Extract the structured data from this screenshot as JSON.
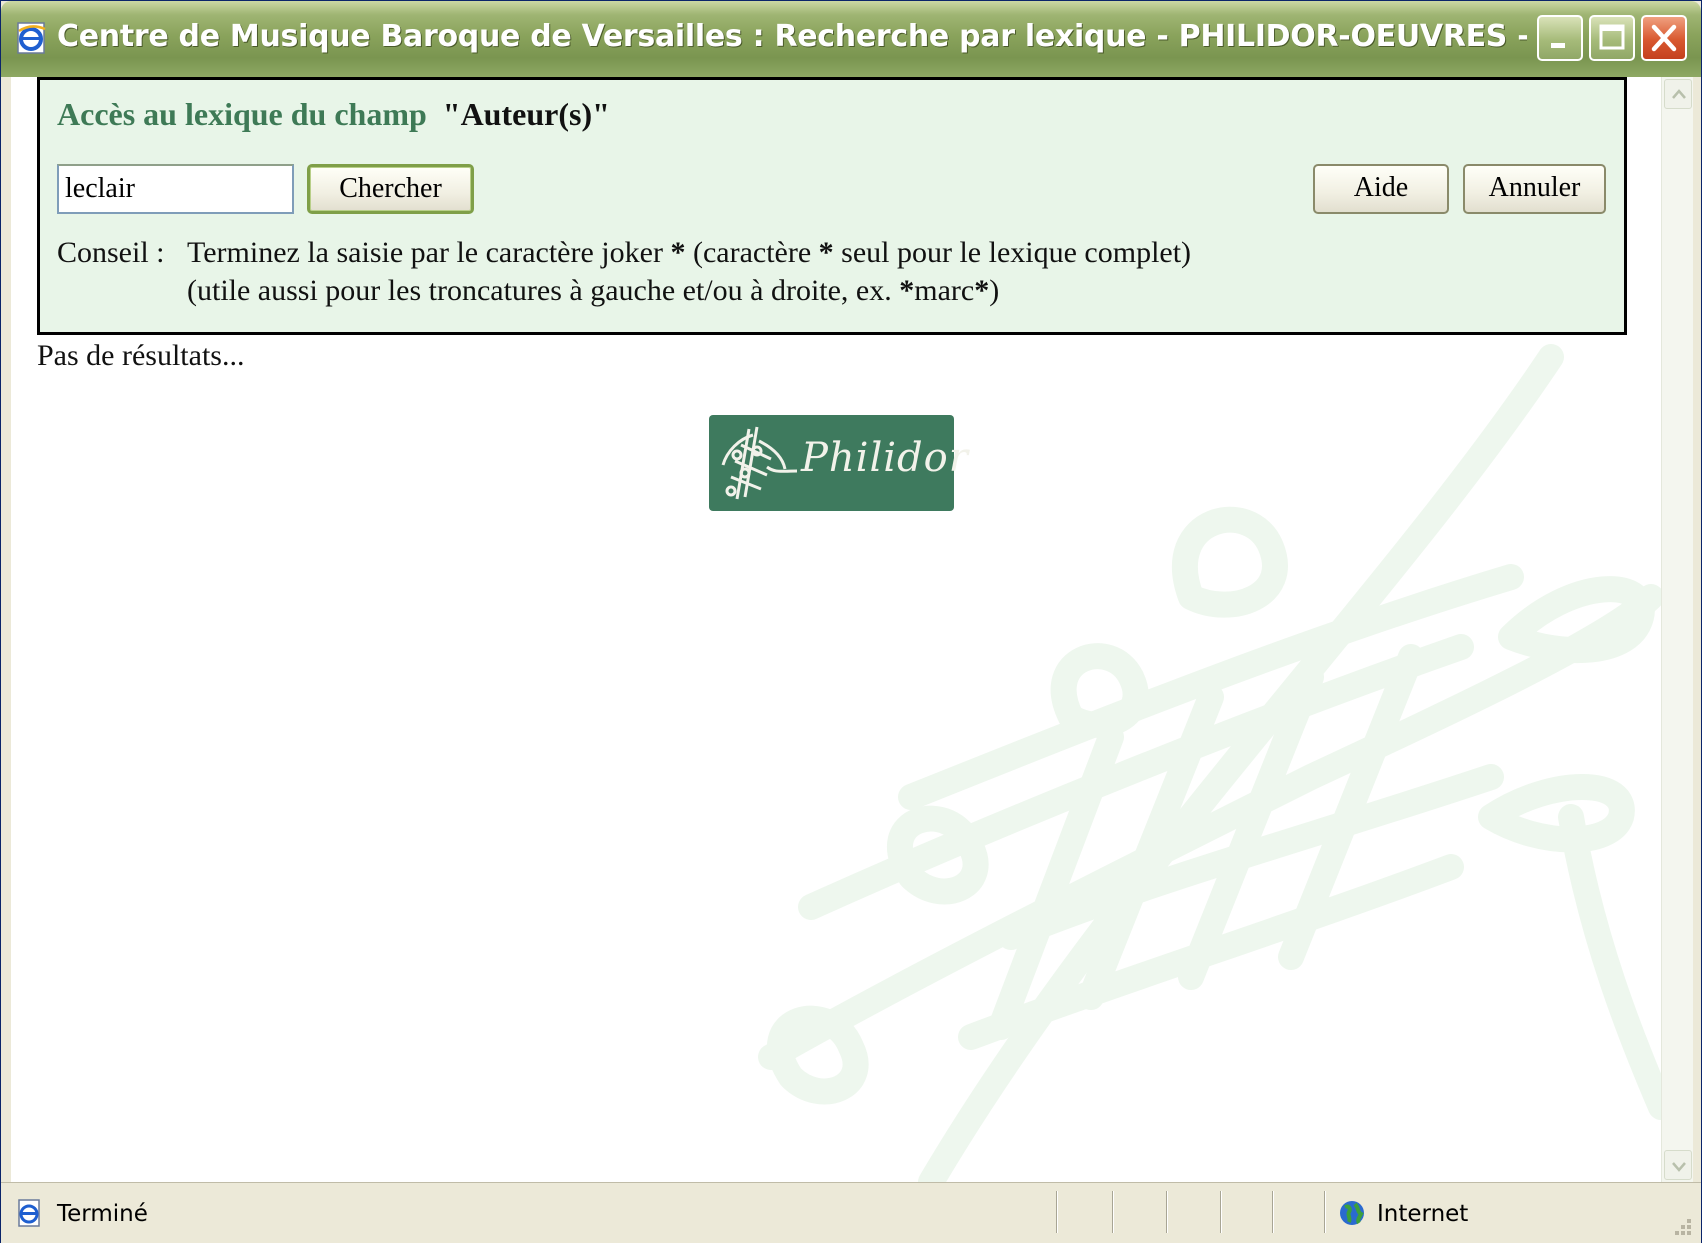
{
  "window": {
    "title": "Centre de Musique Baroque de Versailles : Recherche par lexique - PHILIDOR-OEUVRES - Microsoft Interne..."
  },
  "panel": {
    "title_label": "Accès au lexique du champ",
    "field_name": "\"Auteur(s)\"",
    "search_value": "leclair",
    "search_button": "Chercher",
    "help_button": "Aide",
    "cancel_button": "Annuler",
    "tip_label": "Conseil :",
    "tip_line1_a": "Terminez la saisie par le caractère joker",
    "tip_star": "*",
    "tip_line1_b": "(caractère",
    "tip_line1_c": "seul pour le lexique complet)",
    "tip_line2_a": "(utile aussi pour les troncatures à gauche et/ou à droite, ex.",
    "tip_line2_b": "marc",
    "tip_line2_c": ")"
  },
  "results": {
    "message": "Pas de résultats..."
  },
  "logo": {
    "text": "Philidor"
  },
  "statusbar": {
    "status": "Terminé",
    "zone": "Internet"
  },
  "colors": {
    "titlebar": "#8aa35c",
    "panel_bg": "#e8f5e8",
    "accent_green": "#3e7a56",
    "logo_bg": "#3e7a5e"
  },
  "icons": [
    "ie-icon",
    "minimize-icon",
    "maximize-icon",
    "close-icon",
    "scroll-up-icon",
    "scroll-down-icon",
    "page-done-icon",
    "globe-icon",
    "resize-grip-icon"
  ]
}
